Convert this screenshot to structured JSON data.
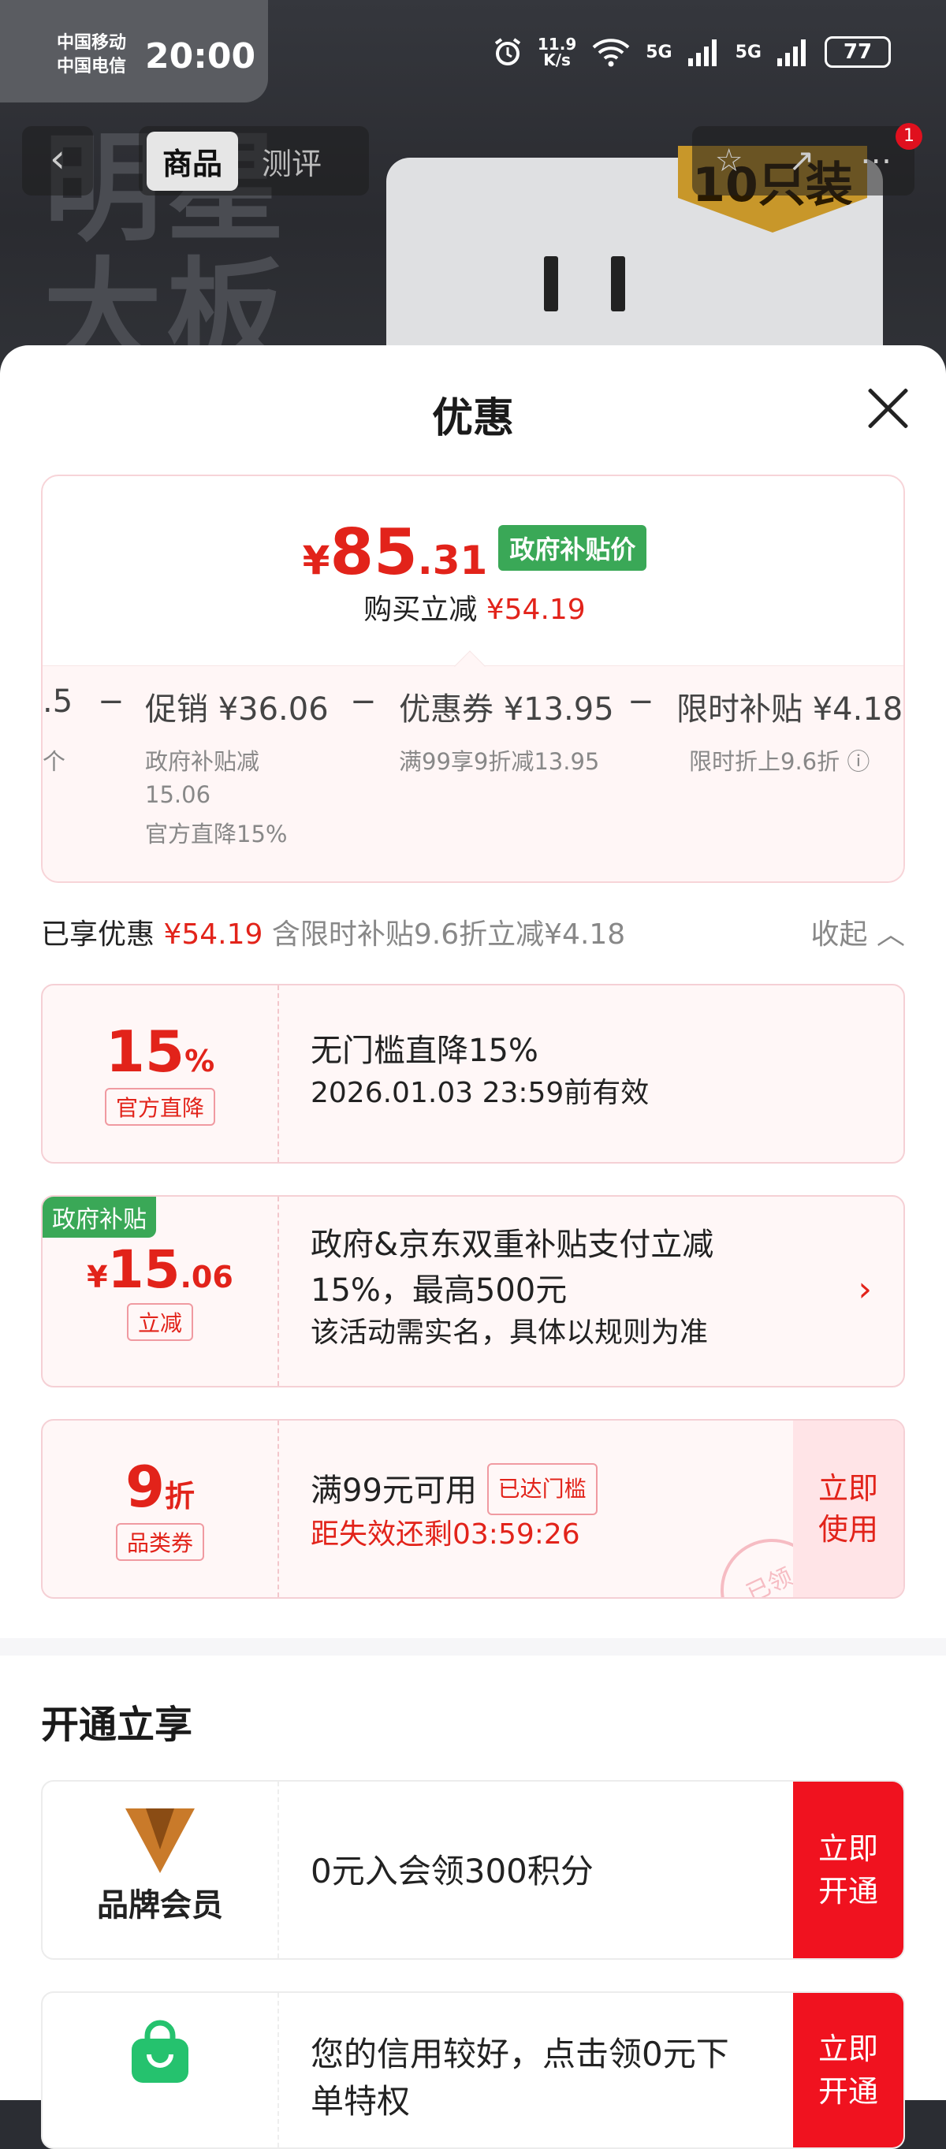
{
  "status_bar": {
    "carrier1": "中国移动",
    "carrier2": "中国电信",
    "time": "20:00",
    "net_speed_value": "11.9",
    "net_speed_unit": "K/s",
    "signal1": "5G",
    "signal2": "5G",
    "battery": "77"
  },
  "background": {
    "big_text_line1": "明星",
    "big_text_line2": "大板",
    "badge": "10只装"
  },
  "navbar": {
    "tabs": [
      "商品",
      "测评"
    ],
    "notification_count": "1"
  },
  "sheet": {
    "title": "优惠"
  },
  "price": {
    "yen": "¥",
    "integer": "85",
    "decimal": ".31",
    "tag": "政府补贴价",
    "sub_label": "购买立减",
    "sub_amount": "¥54.19"
  },
  "breakdown": {
    "lead_value": ".5",
    "lead_sub": "个",
    "minus": "−",
    "items": [
      {
        "label": "促销 ¥36.06",
        "sub1": "政府补贴减",
        "sub2": "15.06",
        "sub3": "官方直降15%"
      },
      {
        "label": "优惠券 ¥13.95",
        "sub1": "满99享9折减13.95"
      },
      {
        "label": "限时补贴 ¥4.18",
        "sub1": "限时折上9.6折"
      }
    ]
  },
  "summary": {
    "label": "已享优惠",
    "amount": "¥54.19",
    "detail": "含限时补贴9.6折立减¥4.18",
    "collapse": "收起"
  },
  "coupons": [
    {
      "big": "15",
      "unit": "%",
      "tag": "官方直降",
      "line1": "无门槛直降15%",
      "line2": "2026.01.03 23:59前有效"
    },
    {
      "corner": "政府补贴",
      "yen": "¥",
      "big": "15",
      "dec": ".06",
      "tag": "立减",
      "line1": "政府&京东双重补贴支付立减",
      "line2": "15%，最高500元",
      "line3": "该活动需实名，具体以规则为准"
    },
    {
      "big": "9",
      "unit": "折",
      "tag": "品类券",
      "line1": "满99元可用",
      "badge": "已达门槛",
      "line2": "距失效还剩03:59:26",
      "btn1": "立即",
      "btn2": "使用",
      "stamp": "已领"
    }
  ],
  "section": {
    "title": "开通立享"
  },
  "members": [
    {
      "name": "品牌会员",
      "text": "0元入会领300积分",
      "btn1": "立即",
      "btn2": "开通"
    },
    {
      "text1": "您的信用较好，点击领0元下",
      "text2": "单特权",
      "btn1": "立即",
      "btn2": "开通"
    }
  ],
  "colors": {
    "accent_red": "#e2231a",
    "gov_green": "#3aa857",
    "button_red": "#f0121f"
  }
}
